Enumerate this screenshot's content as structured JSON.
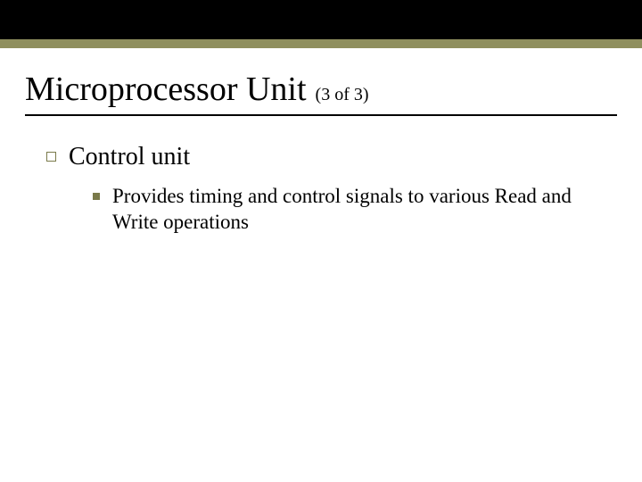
{
  "colors": {
    "topbar": "#000000",
    "accent": "#8f8f5e",
    "bullet": "#7a7a4a"
  },
  "header": {
    "title": "Microprocessor Unit",
    "slug": "(3 of 3)"
  },
  "body": {
    "level1": "Control unit",
    "level2": "Provides timing and control signals to various Read and Write operations"
  }
}
